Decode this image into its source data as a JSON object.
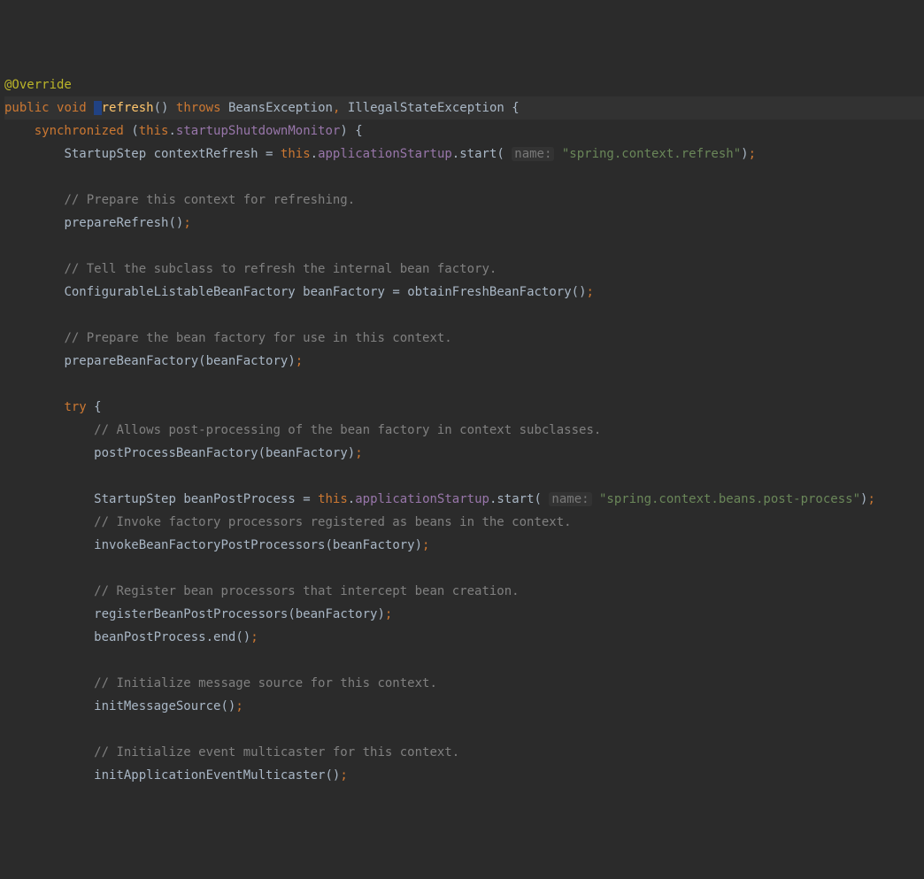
{
  "code": {
    "l1": {
      "ann": "@Override"
    },
    "l2": {
      "pub": "public",
      "void": "void",
      "ref": "refresh",
      "thr": "throws",
      "ex1": "BeansException",
      "ex2": "IllegalStateException",
      "ob": "{"
    },
    "l3": {
      "sync": "synchronized",
      "open": "(",
      "thi": "this",
      "dot": ".",
      "fld": "startupShutdownMonitor",
      "close": ")",
      "ob": "{"
    },
    "l4": {
      "typ": "StartupStep",
      "var": "contextRefresh",
      "eq": "=",
      "thi": "this",
      "dot": ".",
      "fld": "applicationStartup",
      "dot2": ".",
      "m": "start",
      "hint": "name:",
      "str": "\"spring.context.refresh\""
    },
    "c1": "// Prepare this context for refreshing.",
    "l5": {
      "m": "prepareRefresh"
    },
    "c2": "// Tell the subclass to refresh the internal bean factory.",
    "l6": {
      "typ": "ConfigurableListableBeanFactory",
      "var": "beanFactory",
      "eq": "=",
      "m": "obtainFreshBeanFactory"
    },
    "c3": "// Prepare the bean factory for use in this context.",
    "l7": {
      "m": "prepareBeanFactory",
      "arg": "beanFactory"
    },
    "l8": {
      "try": "try",
      "ob": "{"
    },
    "c4": "// Allows post-processing of the bean factory in context subclasses.",
    "l9": {
      "m": "postProcessBeanFactory",
      "arg": "beanFactory"
    },
    "l10": {
      "typ": "StartupStep",
      "var": "beanPostProcess",
      "eq": "=",
      "thi": "this",
      "dot": ".",
      "fld": "applicationStartup",
      "dot2": ".",
      "m": "start",
      "hint": "name:",
      "str": "\"spring.context.beans.post-process\""
    },
    "c5": "// Invoke factory processors registered as beans in the context.",
    "l11": {
      "m": "invokeBeanFactoryPostProcessors",
      "arg": "beanFactory"
    },
    "c6": "// Register bean processors that intercept bean creation.",
    "l12": {
      "m": "registerBeanPostProcessors",
      "arg": "beanFactory"
    },
    "l13": {
      "var": "beanPostProcess",
      "m": "end"
    },
    "c7": "// Initialize message source for this context.",
    "l14": {
      "m": "initMessageSource"
    },
    "c8": "// Initialize event multicaster for this context.",
    "l15": {
      "m": "initApplicationEventMulticaster"
    }
  }
}
